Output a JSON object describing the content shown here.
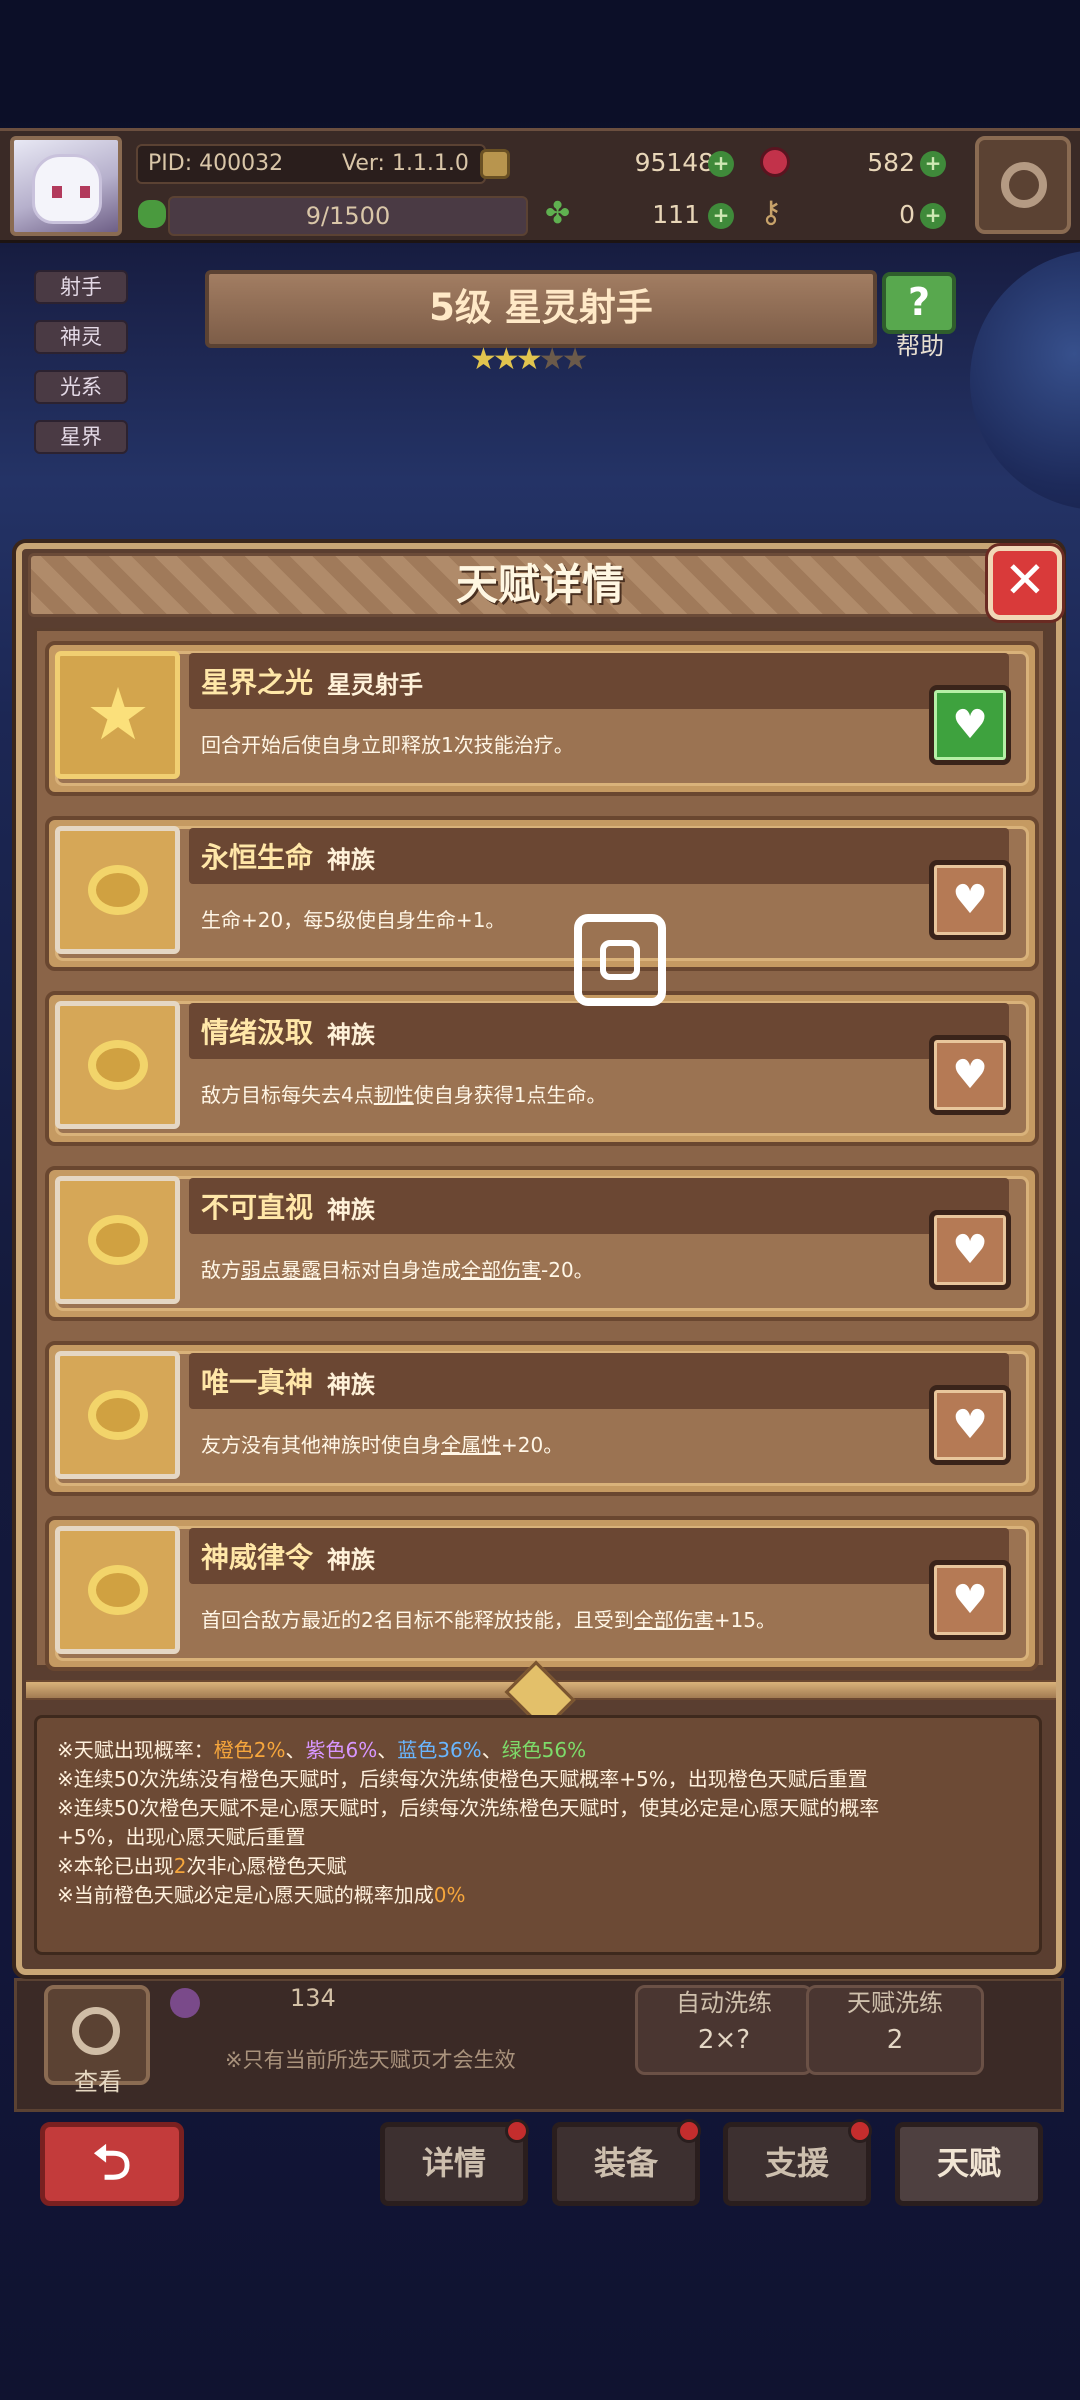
{
  "header": {
    "pid": "PID: 400032",
    "version": "Ver: 1.1.1.0",
    "gold": "951481",
    "gems": "582",
    "exp": "9/1500",
    "clover": "111",
    "key": "0"
  },
  "side_tags": [
    "射手",
    "神灵",
    "光系",
    "星界"
  ],
  "hero": {
    "title": "5级  星灵射手",
    "stars_filled": 3,
    "stars_total": 5,
    "help_label": "帮助"
  },
  "modal": {
    "title": "天赋详情",
    "talents": [
      {
        "name": "星界之光",
        "race": "星灵射手",
        "desc_parts": [
          "回合开始后使自身立即释放1次技能治疗。"
        ],
        "active": true,
        "icon": "star-icon"
      },
      {
        "name": "永恒生命",
        "race": "神族",
        "desc_parts": [
          "生命+20，每5级使自身生命+1。"
        ],
        "active": false,
        "icon": "emblem-icon"
      },
      {
        "name": "情绪汲取",
        "race": "神族",
        "desc_parts": [
          "敌方目标每失去4点",
          "韧性",
          "使自身获得1点生命。"
        ],
        "active": false,
        "icon": "emblem-icon"
      },
      {
        "name": "不可直视",
        "race": "神族",
        "desc_parts": [
          "敌方",
          "弱点暴露",
          "目标对自身造成",
          "全部伤害",
          "-20。"
        ],
        "active": false,
        "icon": "emblem-icon"
      },
      {
        "name": "唯一真神",
        "race": "神族",
        "desc_parts": [
          "友方没有其他神族时使自身",
          "全属性",
          "+20。"
        ],
        "active": false,
        "icon": "emblem-icon"
      },
      {
        "name": "神威律令",
        "race": "神族",
        "desc_parts": [
          "首回合敌方最近的2名目标不能释放技能，且受到",
          "全部伤害",
          "+15。"
        ],
        "active": false,
        "icon": "emblem-icon"
      }
    ],
    "info": {
      "line1_prefix": "※天赋出现概率：",
      "orange": "橙色2%",
      "sep": "、",
      "purple": "紫色6%",
      "blue": "蓝色36%",
      "green": "绿色56%",
      "line2": "※连续50次洗练没有橙色天赋时，后续每次洗练使橙色天赋概率+5%，出现橙色天赋后重置",
      "line3": "※连续50次橙色天赋不是心愿天赋时，后续每次洗练橙色天赋时，使其必定是心愿天赋的概率",
      "line4": "+5%，出现心愿天赋后重置",
      "line5_prefix": "※本轮已出现",
      "line5_num": "2",
      "line5_suffix": "次非心愿橙色天赋",
      "line6_prefix": "※当前橙色天赋必定是心愿天赋的概率加成",
      "line6_num": "0%"
    }
  },
  "lower": {
    "view_label": "查看",
    "count": "134",
    "note": "※只有当前所选天赋页才会生效",
    "auto_label": "自动洗练",
    "auto_cost": "2×?",
    "wash_label": "天赋洗练",
    "wash_cost": "2"
  },
  "nav": {
    "tabs": [
      "详情",
      "装备",
      "支援",
      "天赋"
    ],
    "active": "天赋"
  },
  "colors": {
    "accent_orange": "#f6a63c",
    "accent_purple": "#d896ff",
    "accent_blue": "#69b6ff",
    "accent_green": "#7ddc6a",
    "close_red": "#d93a3a"
  }
}
